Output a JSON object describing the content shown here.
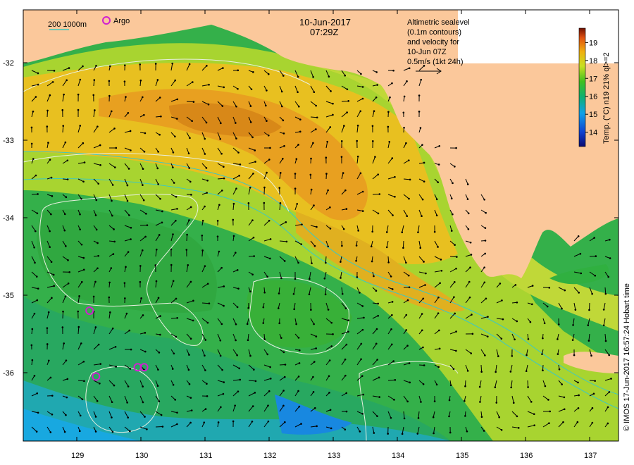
{
  "map": {
    "date": "10-Jun-2017",
    "time": "07:29Z",
    "legend_depths": "200  1000m",
    "argo_label": "Argo",
    "altimetry_note": [
      "Altimetric sealevel",
      "(0.1m contours)",
      "and velocity for",
      "10-Jun 07Z",
      "0.5m/s (1kt 24h)"
    ],
    "credit": "© IMOS 17-Jun-2017 16:57:24 Hobart time",
    "lon_ticks": [
      "129",
      "130",
      "131",
      "132",
      "133",
      "134",
      "135",
      "136",
      "137"
    ],
    "lat_ticks": [
      "-32",
      "-33",
      "-34",
      "-35",
      "-36"
    ],
    "colorbar": {
      "label": "Temp. (°C) n19 21% ql>=2",
      "ticks": [
        "19",
        "18",
        "17",
        "16",
        "15",
        "14"
      ],
      "range": [
        13.2,
        19.8
      ]
    },
    "colors": {
      "land": "#fbc89b",
      "shelf_contour": "#3ec8c0",
      "ssh_contour": "#e8f0e0",
      "argo": "#d020d0"
    },
    "argo_floats": [
      {
        "lon": 129.2,
        "lat": -35.2
      },
      {
        "lon": 129.3,
        "lat": -36.05
      },
      {
        "lon": 129.95,
        "lat": -35.93
      },
      {
        "lon": 130.05,
        "lat": -35.93
      }
    ]
  }
}
